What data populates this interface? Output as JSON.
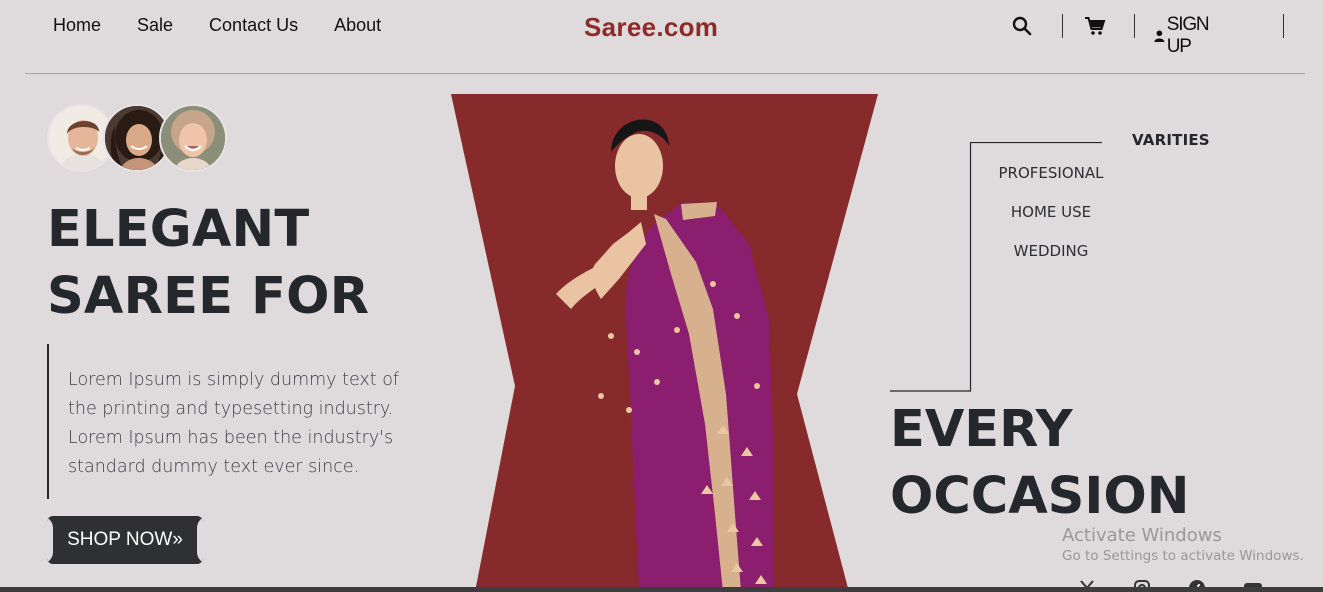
{
  "nav": {
    "links": [
      "Home",
      "Sale",
      "Contact Us",
      "About"
    ],
    "brand": "Saree.com",
    "signup_label": "SIGN UP",
    "icons": [
      "search-icon",
      "cart-icon",
      "user-icon"
    ]
  },
  "hero": {
    "title_line1": "ELEGANT",
    "title_line2": "SAREE FOR",
    "description": "Lorem Ipsum is simply dummy text of the printing and typesetting industry. Lorem Ipsum has been the industry's standard dummy text ever since.",
    "shop_label": "SHOP NOW»"
  },
  "varieties": {
    "title": "VARITIES",
    "items": [
      "PROFESIONAL",
      "HOME USE",
      "WEDDING"
    ]
  },
  "occasion": {
    "line1": "EVERY",
    "line2": "OCCASION"
  },
  "watermark": {
    "line1": "Activate Windows",
    "line2": "Go to Settings to activate Windows."
  },
  "social_icons": [
    "x-icon",
    "instagram-icon",
    "facebook-icon",
    "youtube-icon"
  ],
  "colors": {
    "background": "#dfdadb",
    "brand": "#8e2a2a",
    "panel": "#862a2b",
    "saree": "#8b1e6e",
    "text": "#24272c",
    "button": "#2f3033"
  }
}
